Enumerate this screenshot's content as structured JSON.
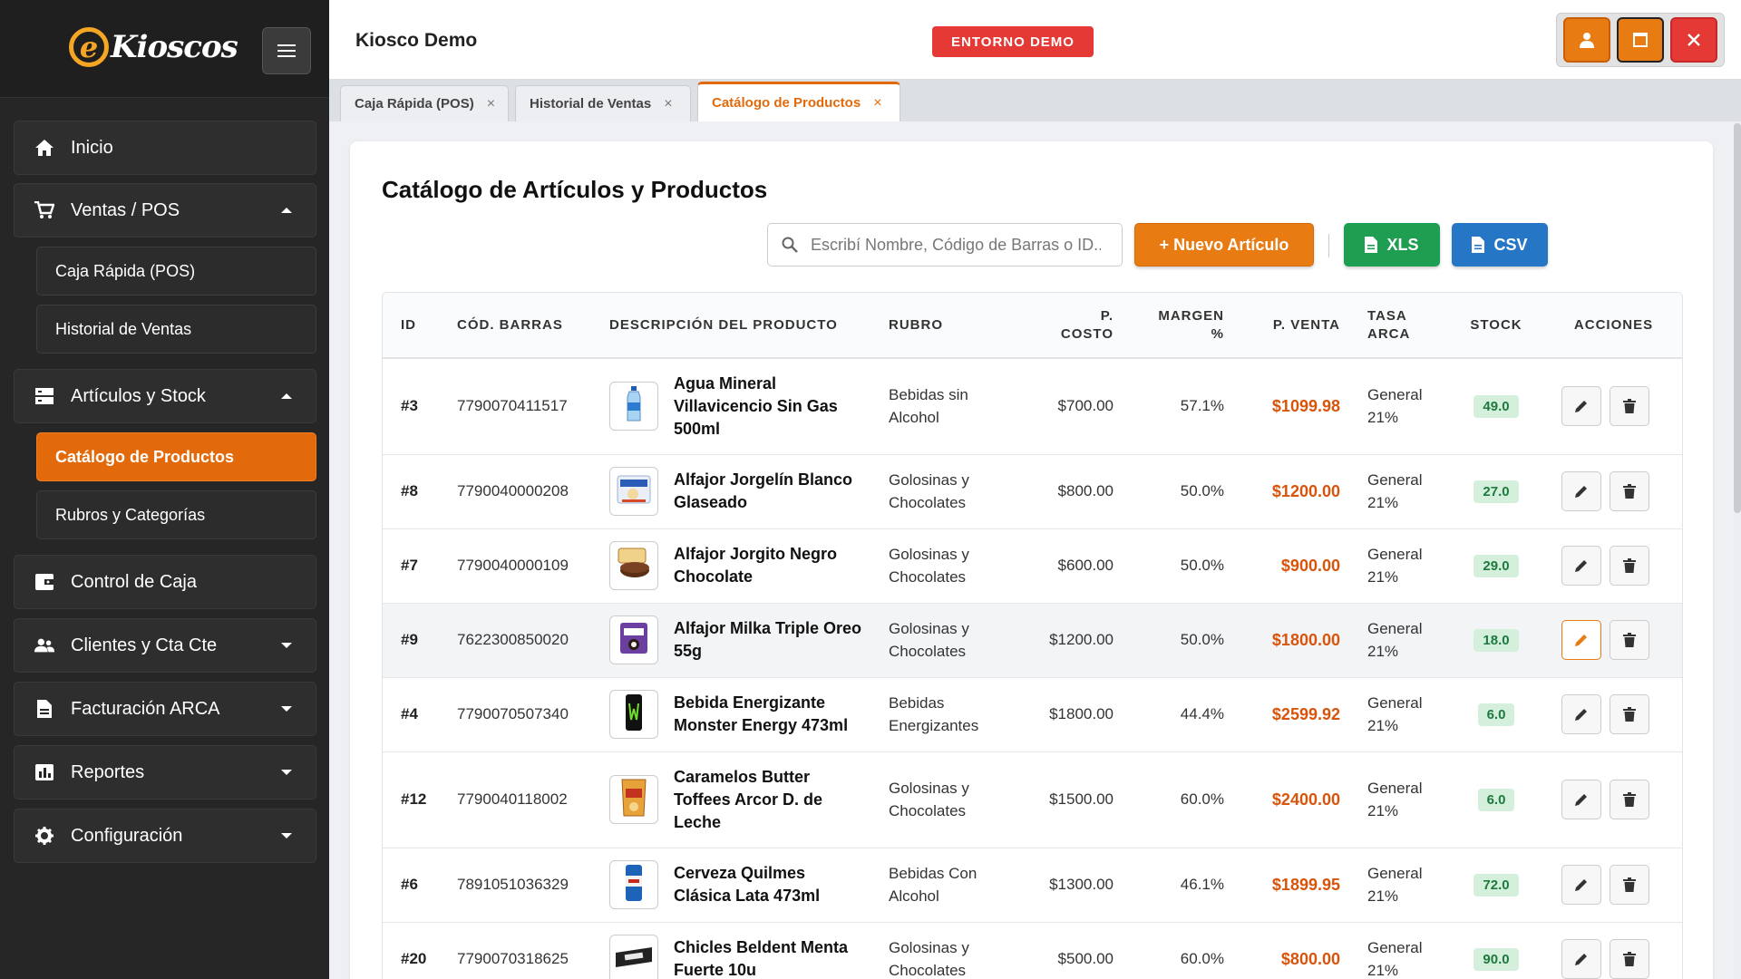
{
  "sidebar": {
    "logo_letter": "e",
    "logo_text": "Kioscos",
    "items": [
      {
        "label": "Inicio"
      },
      {
        "label": "Ventas / POS"
      },
      {
        "label": "Caja Rápida (POS)"
      },
      {
        "label": "Historial de Ventas"
      },
      {
        "label": "Artículos y Stock"
      },
      {
        "label": "Catálogo de Productos"
      },
      {
        "label": "Rubros y Categorías"
      },
      {
        "label": "Control de Caja"
      },
      {
        "label": "Clientes y Cta Cte"
      },
      {
        "label": "Facturación ARCA"
      },
      {
        "label": "Reportes"
      },
      {
        "label": "Configuración"
      }
    ]
  },
  "header": {
    "kiosk_name": "Kiosco Demo",
    "env_badge": "ENTORNO DEMO"
  },
  "tabs": [
    {
      "label": "Caja Rápida (POS)",
      "close": "×"
    },
    {
      "label": "Historial de Ventas",
      "close": "×"
    },
    {
      "label": "Catálogo de Productos",
      "close": "×"
    }
  ],
  "main": {
    "title": "Catálogo de Artículos y Productos",
    "search_placeholder": "Escribí Nombre, Código de Barras o ID...",
    "new_button": "+ Nuevo Artículo",
    "xls_button": "XLS",
    "csv_button": "CSV"
  },
  "table": {
    "columns": {
      "id": "ID",
      "barcode": "CÓD. BARRAS",
      "desc": "DESCRIPCIÓN DEL PRODUCTO",
      "rubro": "RUBRO",
      "cost_1": "P.",
      "cost_2": "COSTO",
      "margin_1": "MARGEN",
      "margin_2": "%",
      "sale": "P. VENTA",
      "tax_1": "TASA",
      "tax_2": "ARCA",
      "stock": "STOCK",
      "actions": "ACCIONES"
    },
    "rows": [
      {
        "id": "#3",
        "barcode": "7790070411517",
        "name": "Agua Mineral Villavicencio Sin Gas 500ml",
        "rubro": "Bebidas sin Alcohol",
        "cost": "$700.00",
        "margin": "57.1%",
        "sale": "$1099.98",
        "tax": "General 21%",
        "stock": "49.0",
        "thumb_icon": "water-bottle-icon"
      },
      {
        "id": "#8",
        "barcode": "7790040000208",
        "name": "Alfajor Jorgelín Blanco Glaseado",
        "rubro": "Golosinas y Chocolates",
        "cost": "$800.00",
        "margin": "50.0%",
        "sale": "$1200.00",
        "tax": "General 21%",
        "stock": "27.0",
        "thumb_icon": "alfajor-white-icon"
      },
      {
        "id": "#7",
        "barcode": "7790040000109",
        "name": "Alfajor Jorgito Negro Chocolate",
        "rubro": "Golosinas y Chocolates",
        "cost": "$600.00",
        "margin": "50.0%",
        "sale": "$900.00",
        "tax": "General 21%",
        "stock": "29.0",
        "thumb_icon": "alfajor-chocolate-icon"
      },
      {
        "id": "#9",
        "barcode": "7622300850020",
        "name": "Alfajor Milka Triple Oreo 55g",
        "rubro": "Golosinas y Chocolates",
        "cost": "$1200.00",
        "margin": "50.0%",
        "sale": "$1800.00",
        "tax": "General 21%",
        "stock": "18.0",
        "thumb_icon": "alfajor-milka-icon"
      },
      {
        "id": "#4",
        "barcode": "7790070507340",
        "name": "Bebida Energizante Monster Energy 473ml",
        "rubro": "Bebidas Energizantes",
        "cost": "$1800.00",
        "margin": "44.4%",
        "sale": "$2599.92",
        "tax": "General 21%",
        "stock": "6.0",
        "thumb_icon": "energy-can-icon"
      },
      {
        "id": "#12",
        "barcode": "7790040118002",
        "name": "Caramelos Butter Toffees Arcor D. de Leche",
        "rubro": "Golosinas y Chocolates",
        "cost": "$1500.00",
        "margin": "60.0%",
        "sale": "$2400.00",
        "tax": "General 21%",
        "stock": "6.0",
        "thumb_icon": "candy-bag-icon"
      },
      {
        "id": "#6",
        "barcode": "7891051036329",
        "name": "Cerveza Quilmes Clásica Lata 473ml",
        "rubro": "Bebidas Con Alcohol",
        "cost": "$1300.00",
        "margin": "46.1%",
        "sale": "$1899.95",
        "tax": "General 21%",
        "stock": "72.0",
        "thumb_icon": "beer-can-icon"
      },
      {
        "id": "#20",
        "barcode": "7790070318625",
        "name": "Chicles Beldent Menta Fuerte 10u",
        "rubro": "Golosinas y Chocolates",
        "cost": "$500.00",
        "margin": "60.0%",
        "sale": "$800.00",
        "tax": "General 21%",
        "stock": "90.0",
        "thumb_icon": "gum-pack-icon"
      }
    ]
  },
  "colors": {
    "accent": "#e97b13",
    "sidebar_bg": "#262626",
    "price": "#d9540b",
    "stock_bg": "#d4f0dc",
    "stock_text": "#1e7a3c",
    "danger": "#e53935",
    "xls": "#1e9e50",
    "csv": "#2576c4"
  }
}
